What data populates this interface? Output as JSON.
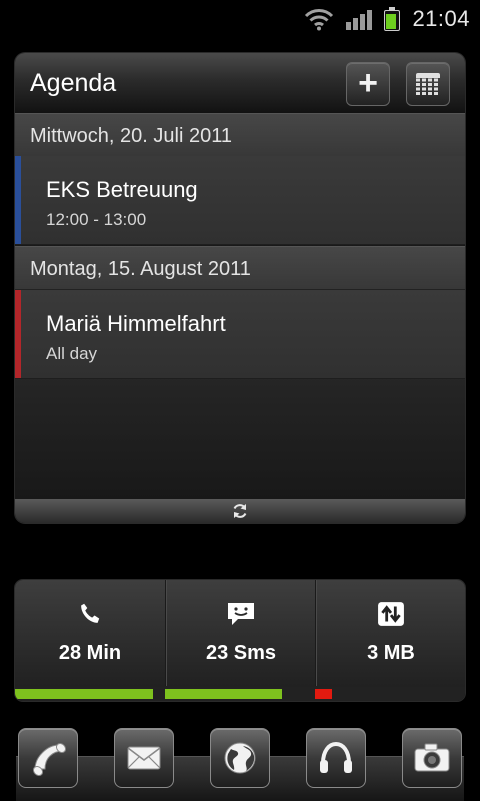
{
  "status_bar": {
    "time": "21:04",
    "icons": [
      "wifi-icon",
      "signal-icon",
      "battery-icon"
    ]
  },
  "agenda": {
    "title": "Agenda",
    "buttons": [
      "add-icon",
      "calendar-icon"
    ],
    "groups": [
      {
        "date": "Mittwoch, 20. Juli 2011",
        "events": [
          {
            "title": "EKS Betreuung",
            "time": "12:00 - 13:00",
            "color": "#2a4f9a"
          }
        ]
      },
      {
        "date": "Montag, 15. August 2011",
        "events": [
          {
            "title": "Mariä Himmelfahrt",
            "time": "All day",
            "color": "#b3262a"
          }
        ]
      }
    ],
    "footer_icon": "refresh-icon"
  },
  "usage": [
    {
      "icon": "phone-icon",
      "value": "28 Min",
      "fill": 0.92,
      "color": "#7ec21e"
    },
    {
      "icon": "message-icon",
      "value": "23 Sms",
      "fill": 0.78,
      "color": "#7ec21e"
    },
    {
      "icon": "data-transfer-icon",
      "value": "3 MB",
      "fill": 0.11,
      "color": "#e21a10"
    }
  ],
  "dock": [
    "phone-icon",
    "mail-icon",
    "browser-globe-icon",
    "music-headphones-icon",
    "camera-icon"
  ]
}
